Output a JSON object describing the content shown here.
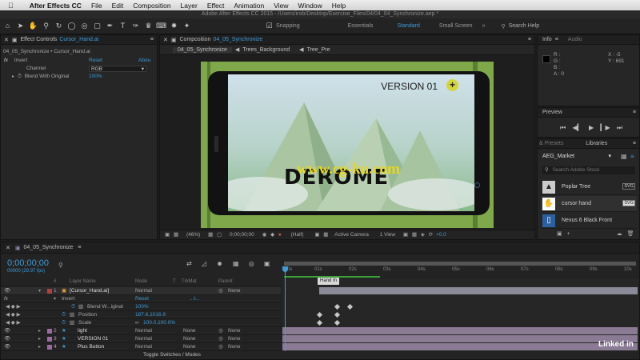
{
  "menubar": {
    "app": "After Effects CC",
    "items": [
      "File",
      "Edit",
      "Composition",
      "Layer",
      "Effect",
      "Animation",
      "View",
      "Window",
      "Help"
    ]
  },
  "window_title": "Adobe After Effects CC 2015 - /Users/irob/Desktop/Exercise_Files/04/04_04_Synchronize.aep *",
  "toolbar": {
    "snapping": "Snapping",
    "workspaces": [
      "Essentials",
      "Standard",
      "Small Screen"
    ],
    "active_workspace": "Standard",
    "search_placeholder": "Search Help"
  },
  "effect_controls": {
    "tab_prefix": "Effect Controls",
    "tab_layer": "Cursor_Hand.ai",
    "breadcrumb": "04_05_Synchronize • Cursor_Hand.ai",
    "effect_name": "Invert",
    "reset": "Reset",
    "about": "Abou",
    "channel_label": "Channel",
    "channel_value": "RGB",
    "blend_label": "Blend With Original",
    "blend_value": "100%"
  },
  "composition": {
    "tab_prefix": "Composition",
    "tab_name": "04_05_Synchronize",
    "flow": [
      "04_05_Synchronize",
      "Trees_Background",
      "Tree_Pre"
    ],
    "version_text": "VERSION 01",
    "title_text": "DEROME",
    "watermark": "www.cg-ku.com",
    "footer": {
      "zoom": "(46%)",
      "timecode": "0;00;00;00",
      "resolution": "(Half)",
      "camera": "Active Camera",
      "view": "1 View",
      "exposure": "+0.0"
    }
  },
  "info": {
    "tab": "Info",
    "tab2": "Audio",
    "r": "R :",
    "g": "G :",
    "b": "B :",
    "a": "A : 0",
    "x": "X : -5",
    "y": "Y : 691"
  },
  "preview": {
    "tab": "Preview"
  },
  "libraries": {
    "tab_presets": "& Presets",
    "tab": "Libraries",
    "library_name": "AEG_Market",
    "search_placeholder": "Search Adobe Stock",
    "items": [
      {
        "name": "Poplar Tree",
        "badge": "SVG"
      },
      {
        "name": "cursor hand",
        "badge": "SVG"
      },
      {
        "name": "Nexus 6 Black Front",
        "badge": ""
      }
    ]
  },
  "timeline": {
    "tab": "04_05_Synchronize",
    "timecode": "0;00;00;00",
    "frame_info": "00000 (29.97 fps)",
    "headers": {
      "hash": "#",
      "layer_name": "Layer Name",
      "mode": "Mode",
      "t": "T",
      "trkmat": "TrkMat",
      "parent": "Parent"
    },
    "ruler": [
      "0s",
      "01s",
      "02s",
      "03s",
      "04s",
      "05s",
      "06s",
      "07s",
      "08s",
      "09s",
      "10s"
    ],
    "marker": "Hand In",
    "layers": [
      {
        "num": "1",
        "name": "[Cursor_Hand.ai]",
        "mode": "Normal",
        "trkmat": "",
        "parent": "None"
      },
      {
        "num": "2",
        "name": "light",
        "mode": "Normal",
        "trkmat": "None",
        "parent": "None"
      },
      {
        "num": "3",
        "name": "VERSION 01",
        "mode": "Normal",
        "trkmat": "None",
        "parent": "None"
      },
      {
        "num": "4",
        "name": "Plus Button",
        "mode": "Normal",
        "trkmat": "None",
        "parent": "None"
      }
    ],
    "effect_row": {
      "fx": "fx",
      "name": "Invert",
      "reset": "Reset",
      "dots": "...t..."
    },
    "properties": [
      {
        "name": "Blend W...iginal",
        "value": "100%"
      },
      {
        "name": "Position",
        "value": "187.6,1016.9"
      },
      {
        "name": "Scale",
        "value": "100.0,100.0%"
      }
    ],
    "footer": "Toggle Switches / Modes"
  },
  "brand": "Linked in",
  "colors": {
    "accent": "#3e9bd8",
    "composition_bg": "#7fa84b",
    "timeline_bar": "#8a8a98"
  }
}
